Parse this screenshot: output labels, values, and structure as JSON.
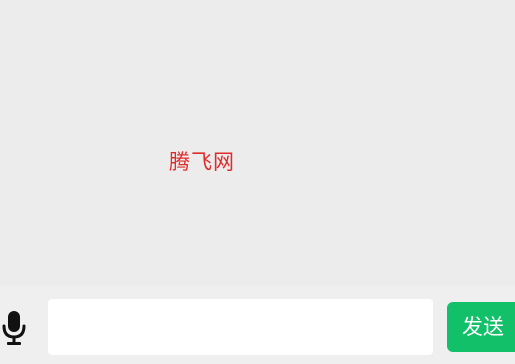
{
  "watermark": {
    "text": "腾飞网",
    "color": "#e02b2b"
  },
  "input_bar": {
    "mic_icon": "microphone-icon",
    "message_value": "",
    "send_label": "发送"
  },
  "colors": {
    "background": "#ececec",
    "accent": "#13c06a",
    "icon": "#111111"
  }
}
